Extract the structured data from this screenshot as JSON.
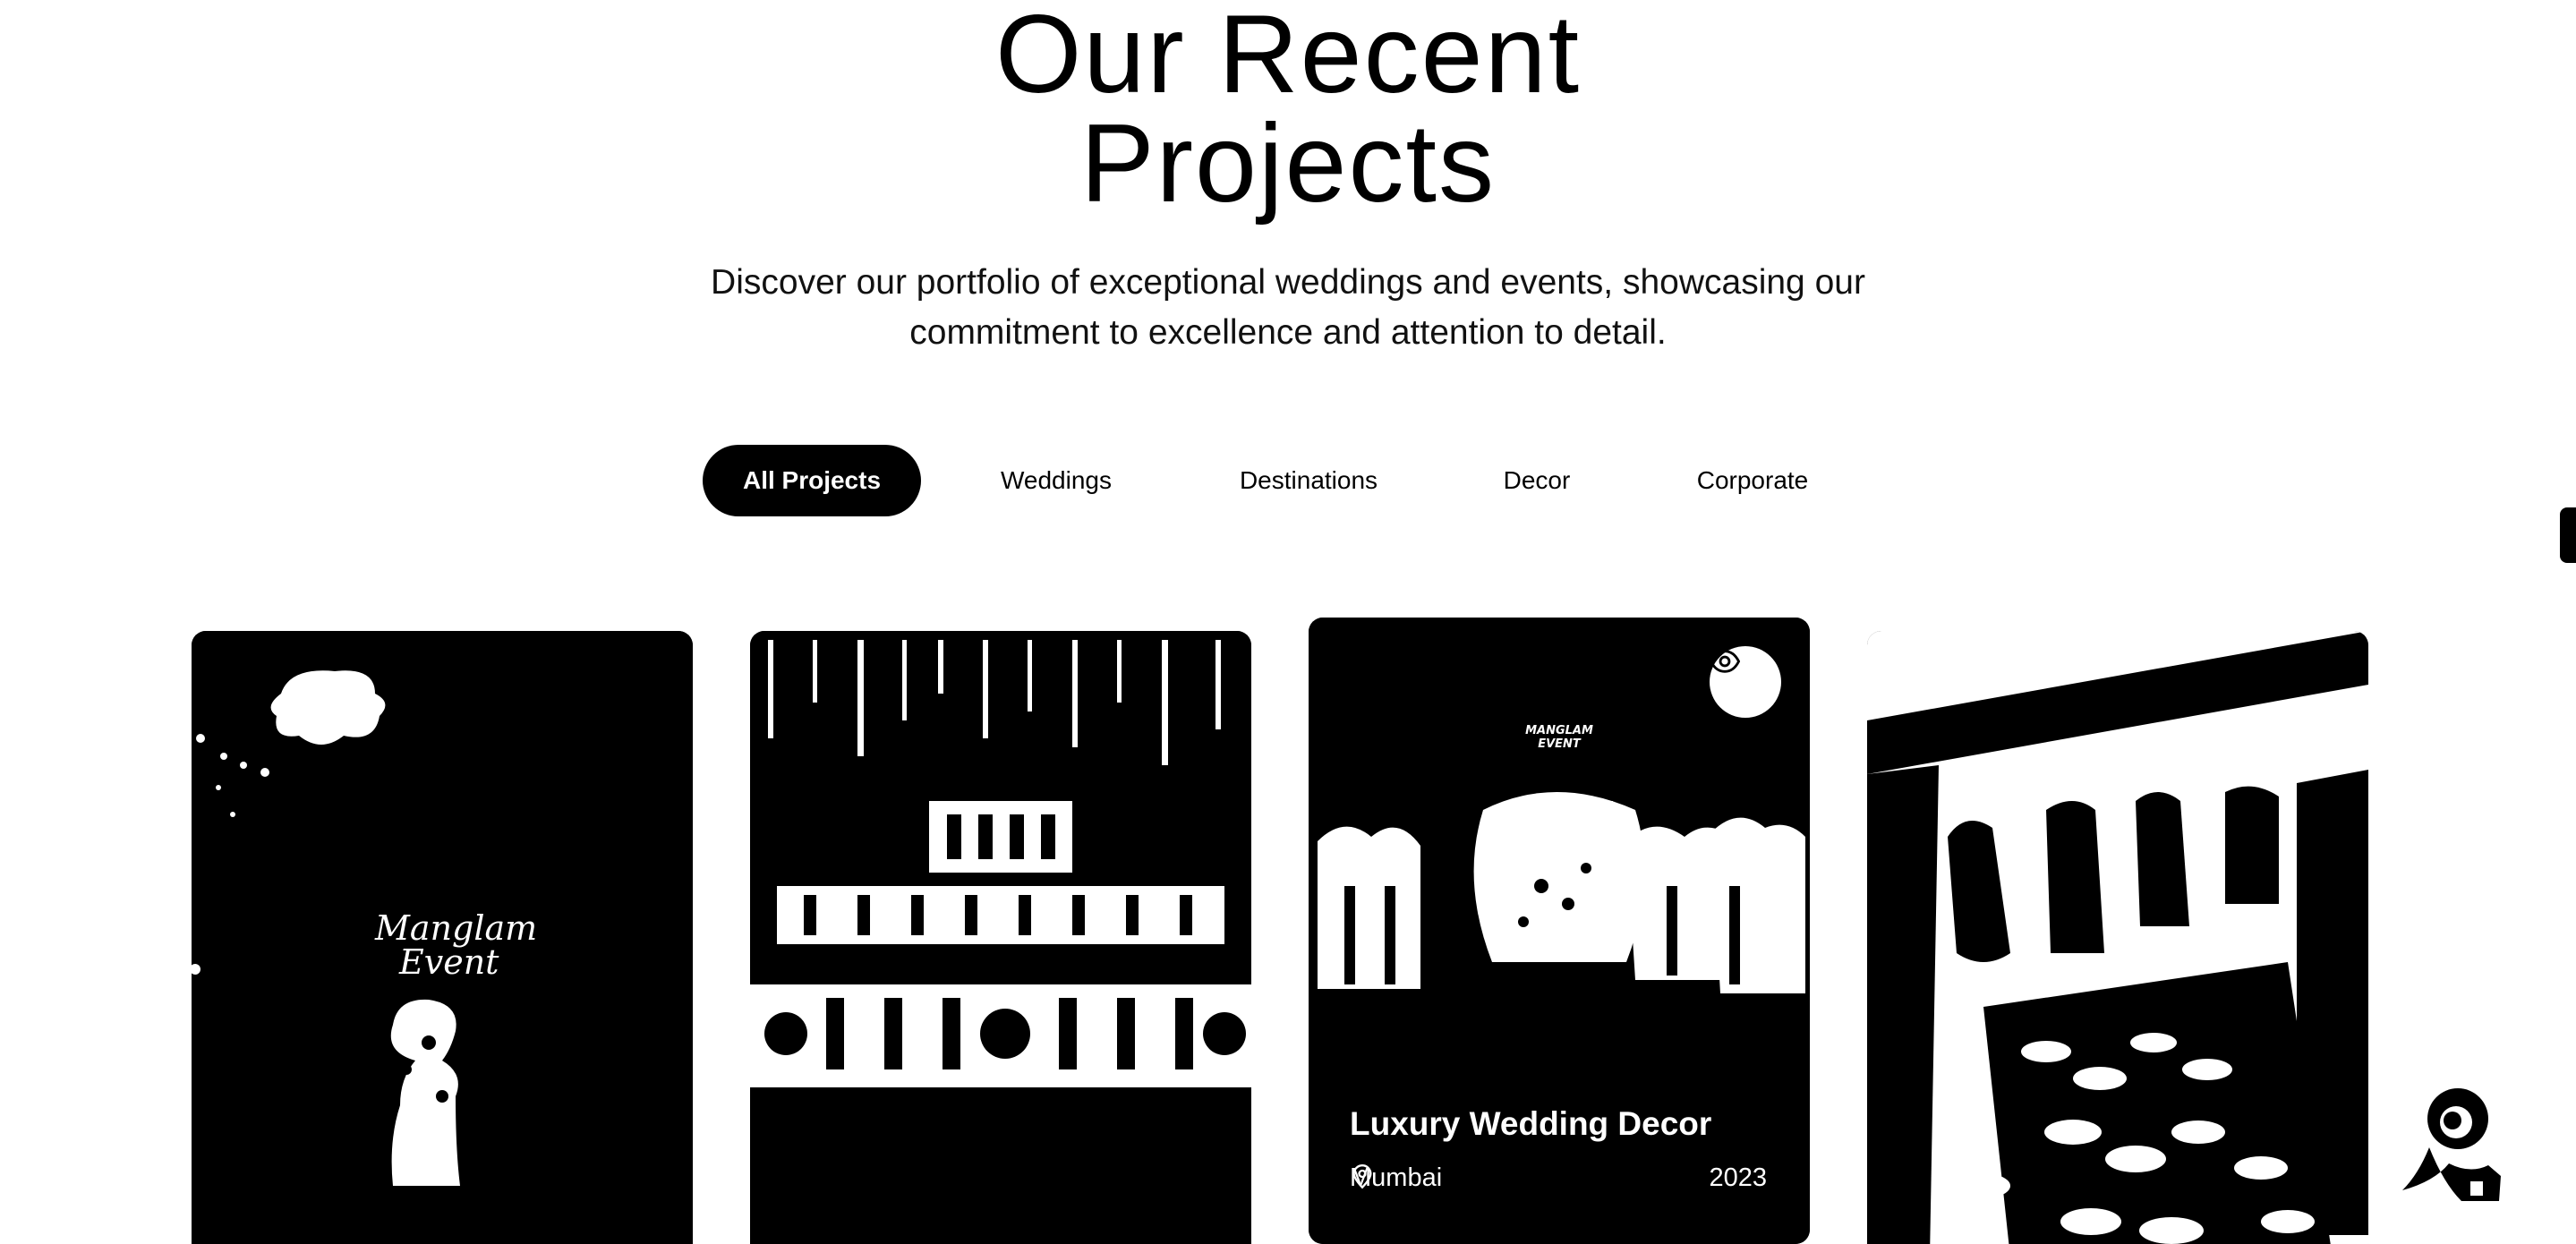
{
  "header": {
    "title_line1": "Our Recent",
    "title_line2": "Projects",
    "subtitle_line1": "Discover our portfolio of exceptional weddings and events, showcasing our",
    "subtitle_line2": "commitment to excellence and attention to detail."
  },
  "filters": [
    {
      "label": "All Projects",
      "active": true
    },
    {
      "label": "Weddings",
      "active": false
    },
    {
      "label": "Destinations",
      "active": false
    },
    {
      "label": "Decor",
      "active": false
    },
    {
      "label": "Corporate",
      "active": false
    }
  ],
  "cards": [
    {
      "logo_text_line1": "Manglam",
      "logo_text_line2": "Event"
    },
    {},
    {
      "logo_text_line1": "MANGLAM",
      "logo_text_line2": "EVENT",
      "title": "Luxury Wedding Decor",
      "location": "Mumbai",
      "year": "2023"
    },
    {}
  ],
  "icons": {
    "view": "eye-icon",
    "location": "location-pin-icon",
    "chat": "chat-assistant-icon"
  },
  "colors": {
    "background": "#ffffff",
    "foreground": "#000000"
  }
}
